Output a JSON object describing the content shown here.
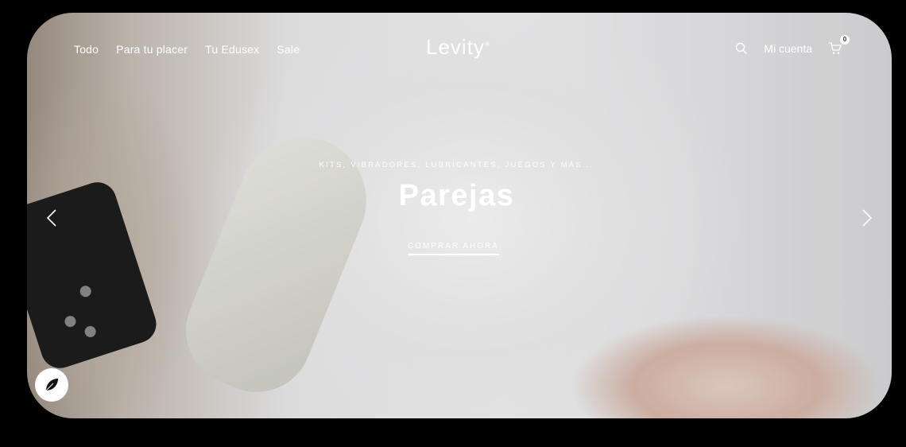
{
  "nav": {
    "items": [
      {
        "label": "Todo"
      },
      {
        "label": "Para tu placer"
      },
      {
        "label": "Tu Edusex"
      },
      {
        "label": "Sale"
      }
    ]
  },
  "logo": {
    "text": "Levity"
  },
  "account": {
    "label": "Mi cuenta"
  },
  "cart": {
    "count": "0"
  },
  "hero": {
    "subtitle": "KITS, VIBRADORES, LUBRICANTES, JUEGOS Y MÁS...",
    "title": "Parejas",
    "cta": "COMPRAR AHORA"
  },
  "icons": {
    "search": "search-icon",
    "cart": "cart-icon",
    "prev": "chevron-left-icon",
    "next": "chevron-right-icon",
    "badge": "leaf-badge-icon"
  }
}
